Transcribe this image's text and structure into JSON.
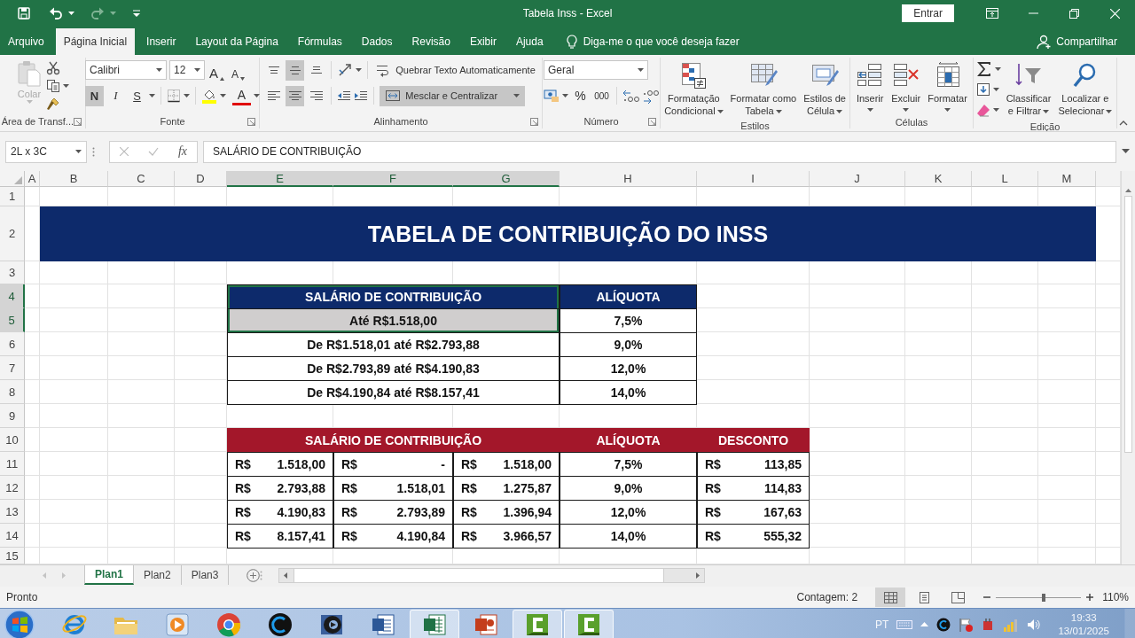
{
  "window": {
    "title": "Tabela Inss - Excel",
    "sign_in": "Entrar"
  },
  "ribbon_tabs": [
    {
      "label": "Arquivo",
      "selected": false
    },
    {
      "label": "Página Inicial",
      "selected": true
    },
    {
      "label": "Inserir",
      "selected": false
    },
    {
      "label": "Layout da Página",
      "selected": false
    },
    {
      "label": "Fórmulas",
      "selected": false
    },
    {
      "label": "Dados",
      "selected": false
    },
    {
      "label": "Revisão",
      "selected": false
    },
    {
      "label": "Exibir",
      "selected": false
    },
    {
      "label": "Ajuda",
      "selected": false
    }
  ],
  "tell_me": "Diga-me o que você deseja fazer",
  "share": "Compartilhar",
  "clipboard": {
    "paste": "Colar",
    "label": "Área de Transf..."
  },
  "font": {
    "name": "Calibri",
    "size": "12",
    "grow": "A",
    "shrink": "A",
    "bold": {
      "label": "N",
      "on": true
    },
    "italic": {
      "label": "I",
      "on": false
    },
    "underline": {
      "label": "S",
      "on": false
    },
    "color_button": "A",
    "label": "Fonte"
  },
  "alignment": {
    "vertical": [
      {
        "selected": false
      },
      {
        "selected": true
      },
      {
        "selected": false
      }
    ],
    "horizontal": [
      {
        "selected": false
      },
      {
        "selected": true
      },
      {
        "selected": false
      }
    ],
    "wrap_text": "Quebrar Texto Automaticamente",
    "merge": {
      "label": "Mesclar e Centralizar",
      "on": true
    },
    "label": "Alinhamento"
  },
  "number": {
    "format": "Geral",
    "percent": "%",
    "thousands": "000",
    "label": "Número"
  },
  "styles": {
    "buttons": [
      "Formatação\nCondicional",
      "Formatar como\nTabela",
      "Estilos de\nCélula"
    ],
    "label": "Estilos"
  },
  "cells": {
    "buttons": [
      "Inserir",
      "Excluir",
      "Formatar"
    ],
    "label": "Células"
  },
  "editing": {
    "buttons": [
      "Classificar\ne Filtrar",
      "Localizar e\nSelecionar"
    ],
    "label": "Edição"
  },
  "formula_bar": {
    "name_box": "2L x 3C",
    "fx": "fx",
    "value": "SALÁRIO DE CONTRIBUIÇÃO"
  },
  "sheet": {
    "columns": [
      {
        "label": "A",
        "selected": false
      },
      {
        "label": "B",
        "selected": false
      },
      {
        "label": "C",
        "selected": false
      },
      {
        "label": "D",
        "selected": false
      },
      {
        "label": "E",
        "selected": true
      },
      {
        "label": "F",
        "selected": true
      },
      {
        "label": "G",
        "selected": true
      },
      {
        "label": "H",
        "selected": false
      },
      {
        "label": "I",
        "selected": false
      },
      {
        "label": "J",
        "selected": false
      },
      {
        "label": "K",
        "selected": false
      },
      {
        "label": "L",
        "selected": false
      },
      {
        "label": "M",
        "selected": false
      }
    ],
    "rows": [
      {
        "label": "1",
        "selected": false
      },
      {
        "label": "2",
        "selected": false
      },
      {
        "label": "3",
        "selected": false
      },
      {
        "label": "4",
        "selected": true
      },
      {
        "label": "5",
        "selected": true
      },
      {
        "label": "6",
        "selected": false
      },
      {
        "label": "7",
        "selected": false
      },
      {
        "label": "8",
        "selected": false
      },
      {
        "label": "9",
        "selected": false
      },
      {
        "label": "10",
        "selected": false
      },
      {
        "label": "11",
        "selected": false
      },
      {
        "label": "12",
        "selected": false
      },
      {
        "label": "13",
        "selected": false
      },
      {
        "label": "14",
        "selected": false
      },
      {
        "label": "15",
        "selected": false
      }
    ],
    "title": "TABELA DE CONTRIBUIÇÃO DO INSS",
    "rate_table": {
      "header": {
        "cells": [
          "SALÁRIO DE CONTRIBUIÇÃO",
          "ALÍQUOTA"
        ],
        "selected": true
      },
      "rows": [
        {
          "range": "Até R$1.518,00",
          "rate": "7,5%",
          "selected": true
        },
        {
          "range": "De R$1.518,01 até R$2.793,88",
          "rate": "9,0%",
          "selected": false
        },
        {
          "range": "De R$2.793,89 até R$4.190,83",
          "rate": "12,0%",
          "selected": false
        },
        {
          "range": "De R$4.190,84 até R$8.157,41",
          "rate": "14,0%",
          "selected": false
        }
      ]
    },
    "discount_table": {
      "header": [
        "SALÁRIO DE CONTRIBUIÇÃO",
        "ALÍQUOTA",
        "DESCONTO"
      ],
      "rows": [
        {
          "cells": [
            [
              "R$",
              "1.518,00"
            ],
            [
              "R$",
              "-"
            ],
            [
              "R$",
              "1.518,00"
            ],
            [
              "7,5%"
            ],
            [
              "R$",
              "113,85"
            ]
          ]
        },
        {
          "cells": [
            [
              "R$",
              "2.793,88"
            ],
            [
              "R$",
              "1.518,01"
            ],
            [
              "R$",
              "1.275,87"
            ],
            [
              "9,0%"
            ],
            [
              "R$",
              "114,83"
            ]
          ]
        },
        {
          "cells": [
            [
              "R$",
              "4.190,83"
            ],
            [
              "R$",
              "2.793,89"
            ],
            [
              "R$",
              "1.396,94"
            ],
            [
              "12,0%"
            ],
            [
              "R$",
              "167,63"
            ]
          ]
        },
        {
          "cells": [
            [
              "R$",
              "8.157,41"
            ],
            [
              "R$",
              "4.190,84"
            ],
            [
              "R$",
              "3.966,57"
            ],
            [
              "14,0%"
            ],
            [
              "R$",
              "555,32"
            ]
          ]
        }
      ]
    }
  },
  "sheet_tabs": [
    {
      "label": "Plan1",
      "selected": true
    },
    {
      "label": "Plan2",
      "selected": false
    },
    {
      "label": "Plan3",
      "selected": false
    }
  ],
  "status": {
    "ready": "Pronto",
    "count": "Contagem: 2",
    "views": [
      {
        "selected": true
      },
      {
        "selected": false
      },
      {
        "selected": false
      }
    ],
    "zoom": {
      "level": 0.56,
      "reading": "110%"
    }
  },
  "taskbar": {
    "apps": [
      {
        "kind": "ie",
        "selected": false
      },
      {
        "kind": "folder",
        "selected": false
      },
      {
        "kind": "media",
        "selected": false
      },
      {
        "kind": "chrome",
        "selected": false
      },
      {
        "kind": "cleaner",
        "selected": false
      },
      {
        "kind": "viewer",
        "selected": false
      },
      {
        "kind": "word",
        "selected": false
      },
      {
        "kind": "excel",
        "selected": true
      },
      {
        "kind": "powerpoint",
        "selected": false
      },
      {
        "kind": "recorder",
        "selected": true
      },
      {
        "kind": "recorder",
        "selected": true
      }
    ],
    "language": "PT",
    "time": "19:33",
    "date": "13/01/2025"
  }
}
